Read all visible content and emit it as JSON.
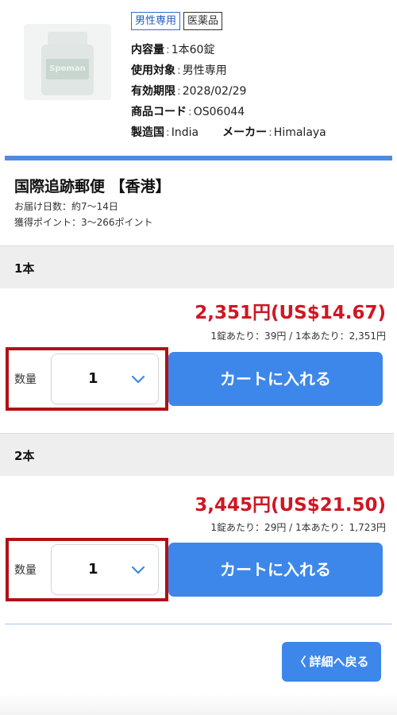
{
  "product": {
    "image_label": "Speman",
    "tags": [
      "男性専用",
      "医薬品"
    ],
    "specs": {
      "content_key": "内容量",
      "content_val": "1本60錠",
      "target_key": "使用対象",
      "target_val": "男性専用",
      "expiry_key": "有効期限",
      "expiry_val": "2028/02/29",
      "code_key": "商品コード",
      "code_val": "OS06044",
      "origin_key": "製造国",
      "origin_val": "India",
      "maker_key": "メーカー",
      "maker_val": "Himalaya",
      "sep": ":"
    }
  },
  "shipping": {
    "title": "国際追跡郵便 【香港】",
    "delivery": "お届け日数：約7〜14日",
    "points": "獲得ポイント：3〜266ポイント"
  },
  "options": [
    {
      "name": "1本",
      "price": "2,351円(US$14.67)",
      "unit": "1錠あたり：39円 / 1本あたり：2,351円",
      "qty_label": "数量",
      "qty_value": "1",
      "cart_label": "カートに入れる"
    },
    {
      "name": "2本",
      "price": "3,445円(US$21.50)",
      "unit": "1錠あたり：29円 / 1本あたり：1,723円",
      "qty_label": "数量",
      "qty_value": "1",
      "cart_label": "カートに入れる"
    }
  ],
  "back_button": {
    "arrow": "〈",
    "label": "詳細へ戻る"
  },
  "colors": {
    "accent": "#3e87ea",
    "price": "#d01622",
    "highlight": "#b11116"
  },
  "icons": {
    "dropdown": "chevron-down-icon"
  }
}
